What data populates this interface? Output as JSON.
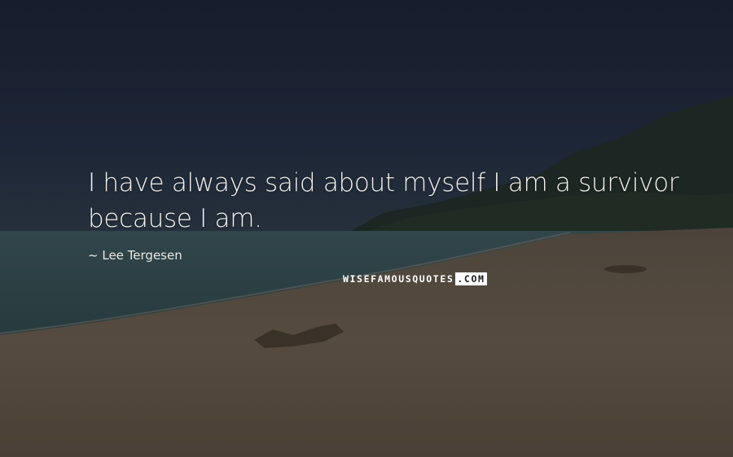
{
  "quote": {
    "text": "I have always said about myself I am a survivor because I am.",
    "author_prefix": "~",
    "author": "Lee Tergesen"
  },
  "watermark": {
    "part1": "WISEFAMOUSQUOTES",
    "part2": ".COM"
  },
  "colors": {
    "sky": "#1a2233",
    "sea": "#2d4247",
    "sand": "#574c41",
    "text": "#f4f2ee"
  }
}
